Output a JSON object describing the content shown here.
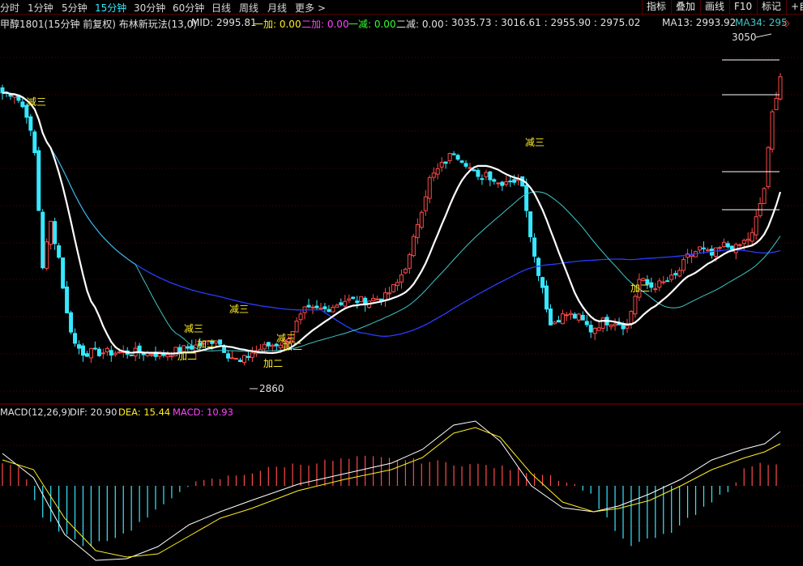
{
  "timeframes": [
    "分时",
    "1分钟",
    "5分钟",
    "15分钟",
    "30分钟",
    "60分钟",
    "日线",
    "周线",
    "月线",
    "更多 >"
  ],
  "active_timeframe": "15分钟",
  "toolbar": [
    "指标",
    "叠加",
    "画线",
    "F10",
    "标记",
    "+自"
  ],
  "info": {
    "title": "甲醇1801(15分钟 前复权) 布林新玩法(13,0)",
    "mid": "MID: 2995.81",
    "jia1": "一加: 0.00",
    "jia2": "二加: 0.00",
    "jian1": "一减: 0.00",
    "jian2": "二减: 0.00",
    "vals": ": 3035.73 : 3016.61 : 2955.90 : 2975.02",
    "ma13": "MA13: 2993.92",
    "ma34": "MA34: 295"
  },
  "macd": {
    "title": "MACD(12,26,9)",
    "dif": "DIF: 20.90",
    "dea": "DEA: 15.44",
    "macd": "MACD: 10.93"
  },
  "annotations": {
    "high": "3050",
    "low": "2860",
    "jian3": "减三",
    "jia2": "加二"
  },
  "colors": {
    "up": "#ff4a4a",
    "down": "#36e8ff",
    "mid": "#ffffff",
    "ma13": "#3fc6c6",
    "ma34": "#2a3cff",
    "dea": "#ffee22",
    "macd": "#ff44ff",
    "jia1": "#ffee22",
    "jia2": "#ff44ff",
    "jian1": "#33ff33"
  }
}
